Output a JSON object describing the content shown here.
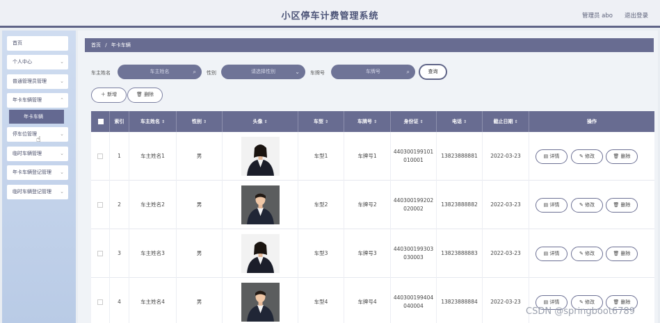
{
  "header": {
    "title": "小区停车计费管理系统",
    "user": "管理员 abo",
    "logout": "退出登录"
  },
  "sidebar": {
    "items": [
      {
        "label": "首页",
        "has_chevron": false
      },
      {
        "label": "个人中心",
        "has_chevron": true
      },
      {
        "label": "普通管理员管理",
        "has_chevron": true
      },
      {
        "label": "年卡车辆管理",
        "has_chevron": true
      },
      {
        "label": "停车位管理",
        "has_chevron": true
      },
      {
        "label": "临时车辆管理",
        "has_chevron": true
      },
      {
        "label": "年卡车辆登记管理",
        "has_chevron": true
      },
      {
        "label": "临时车辆登记管理",
        "has_chevron": true
      }
    ],
    "active_sub": "年卡车辆"
  },
  "breadcrumb": {
    "home": "首页",
    "sep": "/",
    "current": "年卡车辆"
  },
  "search": {
    "owner_label": "车主姓名",
    "owner_placeholder": "车主姓名",
    "gender_label": "性别",
    "gender_placeholder": "请选择性别",
    "plate_label": "车牌号",
    "plate_placeholder": "车牌号",
    "search_button": "查询"
  },
  "actions": {
    "add": "新增",
    "delete": "删除"
  },
  "table": {
    "columns": [
      "索引",
      "车主姓名",
      "性别",
      "头像",
      "车型",
      "车牌号",
      "身份证",
      "电话",
      "截止日期",
      "操作"
    ],
    "rows": [
      {
        "index": "1",
        "name": "车主姓名1",
        "gender": "男",
        "model": "车型1",
        "plate": "车牌号1",
        "id1": "440300199101",
        "id2": "010001",
        "phone": "13823888881",
        "date": "2022-03-23",
        "avatar": "woman"
      },
      {
        "index": "2",
        "name": "车主姓名2",
        "gender": "男",
        "model": "车型2",
        "plate": "车牌号2",
        "id1": "440300199202",
        "id2": "020002",
        "phone": "13823888882",
        "date": "2022-03-23",
        "avatar": "man"
      },
      {
        "index": "3",
        "name": "车主姓名3",
        "gender": "男",
        "model": "车型3",
        "plate": "车牌号3",
        "id1": "440300199303",
        "id2": "030003",
        "phone": "13823888883",
        "date": "2022-03-23",
        "avatar": "woman"
      },
      {
        "index": "4",
        "name": "车主姓名4",
        "gender": "男",
        "model": "车型4",
        "plate": "车牌号4",
        "id1": "440300199404",
        "id2": "040004",
        "phone": "13823888884",
        "date": "2022-03-23",
        "avatar": "man"
      }
    ],
    "row_buttons": {
      "detail": "详情",
      "edit": "修改",
      "delete": "删除"
    }
  },
  "watermark": "CSDN @springboot6789",
  "colors": {
    "primary": "#686c91",
    "sidebar": "#c5d4ec",
    "header_border": "#5f6487"
  }
}
